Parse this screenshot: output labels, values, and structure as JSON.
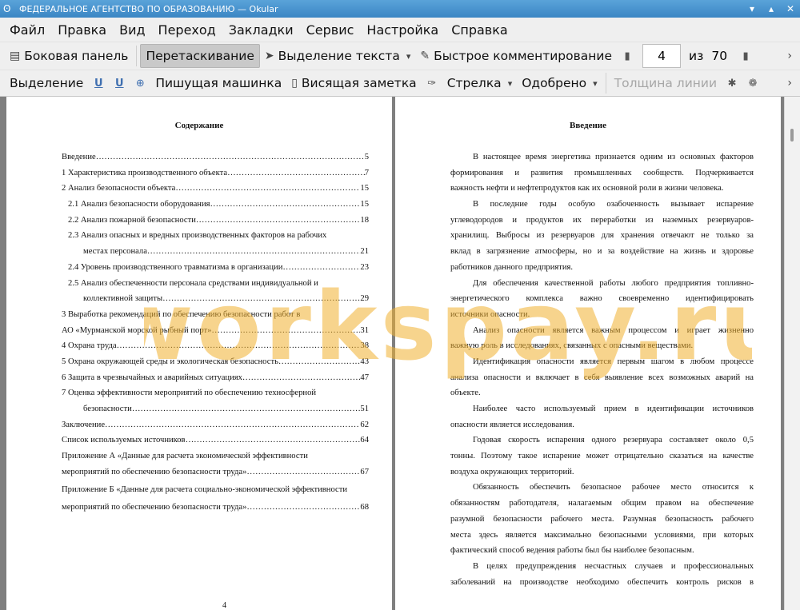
{
  "window": {
    "title": "ФЕДЕРАЛЬНОЕ АГЕНТСТВО ПО ОБРАЗОВАНИЮ  — Okular"
  },
  "menu": [
    "Файл",
    "Правка",
    "Вид",
    "Переход",
    "Закладки",
    "Сервис",
    "Настройка",
    "Справка"
  ],
  "toolbar1": {
    "sidebar": "Боковая панель",
    "browse": "Перетаскивание",
    "text_select": "Выделение текста",
    "annotate": "Быстрое комментирование",
    "page_current": "4",
    "page_of": "из",
    "page_total": "70"
  },
  "toolbar2": {
    "highlight": "Выделение",
    "typewriter": "Пишущая машинка",
    "note": "Висящая заметка",
    "arrow": "Стрелка",
    "stamp": "Одобрено",
    "line_width": "Толщина линии"
  },
  "left_page": {
    "title": "Содержание",
    "toc": [
      {
        "t": "Введение",
        "p": "5"
      },
      {
        "t": "1 Характеристика производственного объекта",
        "p": "7"
      },
      {
        "t": "2  Анализ безопасности объекта",
        "p": "15"
      },
      {
        "t": "2.1 Анализ безопасности оборудования",
        "p": "15"
      },
      {
        "t": "2.2 Анализ пожарной безопасности",
        "p": "18"
      },
      {
        "t": "2.3 Анализ опасных и вредных производственных факторов на рабочих",
        "p": ""
      },
      {
        "t": "местах персонала",
        "p": "21"
      },
      {
        "t": "2.4 Уровень производственного травматизма в организации",
        "p": "23"
      },
      {
        "t": "2.5 Анализ обеспеченности персонала средствами индивидуальной и",
        "p": ""
      },
      {
        "t": "коллективной защиты",
        "p": "29"
      },
      {
        "t": "3 Выработка рекомендаций по обеспечению безопасности работ в",
        "p": ""
      },
      {
        "t": "АО «Мурманской морской рыбный порт»",
        "p": "31"
      },
      {
        "t": "4  Охрана труда",
        "p": "38"
      },
      {
        "t": "5  Охрана окружающей среды и экологическая безопасность",
        "p": "43"
      },
      {
        "t": "6  Защита в чрезвычайных и аварийных ситуациях",
        "p": "47"
      },
      {
        "t": "7 Оценка эффективности мероприятий по обеспечению техносферной",
        "p": ""
      },
      {
        "t": "безопасности",
        "p": "51"
      },
      {
        "t": "Заключение",
        "p": "62"
      },
      {
        "t": "Список используемых источников",
        "p": "64"
      },
      {
        "t": "Приложение А «Данные для расчета экономической эффективности",
        "p": ""
      },
      {
        "t": "мероприятий по обеспечению безопасности труда»",
        "p": "67"
      },
      {
        "t": "Приложение Б «Данные для расчета социально-экономической эффективности",
        "p": ""
      },
      {
        "t": "мероприятий по обеспечению безопасности труда»",
        "p": "68"
      }
    ],
    "page_number": "4"
  },
  "right_page": {
    "title": "Введение",
    "lines": [
      "В настоящее время энергетика признается одним из основных факторов",
      "формирования и развития промышленных сообществ. Подчеркивается",
      "важность нефти и нефтепродуктов как их основной роли в жизни человека.",
      "В последние годы особую озабоченность вызывает испарение",
      "углеводородов и продуктов их переработки из наземных резервуаров-",
      "хранилищ. Выбросы из резервуаров для хранения отвечают не только за",
      "вклад в загрязнение атмосферы, но и за воздействие на жизнь и здоровье",
      "работников данного предприятия.",
      "Для обеспечения качественной работы любого предприятия топливно-",
      "энергетического комплекса важно своевременно идентифицировать",
      "источники опасности.",
      "Анализ опасности является важным процессом и играет жизненно",
      "важную роль в исследованиях, связанных с опасными веществами.",
      "Идентификация опасности является первым шагом в любом процессе",
      "анализа опасности и включает в себя выявление всех возможных аварий на",
      "объекте.",
      "Наиболее часто используемый прием в идентификации источников",
      "опасности является исследования.",
      "Годовая скорость испарения одного резервуара составляет около 0,5",
      "тонны. Поэтому такое испарение может отрицательно сказаться на качестве",
      "воздуха окружающих территорий.",
      "Обязанность обеспечить безопасное рабочее место относится к",
      "обязанностям работодателя, налагаемым общим правом на обеспечение",
      "разумной безопасности рабочего места. Разумная безопасность рабочего",
      "места здесь является максимально безопасными условиями, при которых",
      "фактический способ ведения работы был бы наиболее безопасным.",
      "В целях предупреждения несчастных случаев и профессиональных",
      "заболеваний на производстве необходимо обеспечить контроль рисков в"
    ],
    "indent": [
      0,
      3,
      8,
      11,
      13,
      16,
      18,
      21,
      26
    ],
    "last": [
      2,
      7,
      10,
      12,
      15,
      17,
      20,
      25
    ]
  },
  "watermark": {
    "text": "workspay.ru",
    "color": "#f0b030"
  }
}
